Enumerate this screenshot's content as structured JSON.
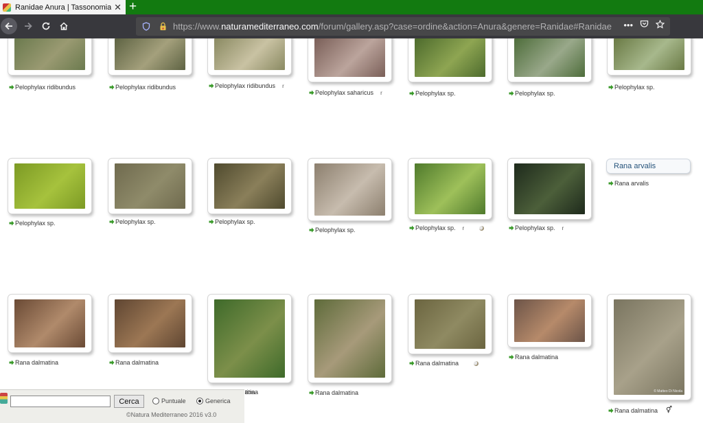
{
  "browser": {
    "tab_title": "Ranidae Anura | Tassonomia Ra",
    "url_scheme": "https://www.",
    "url_host": "naturamediterraneo.com",
    "url_path": "/forum/gallery.asp?case=ordine&action=Anura&genere=Ranidae#Ranidae",
    "icons": [
      "back-icon",
      "forward-icon",
      "reload-icon",
      "home-icon",
      "shield-icon",
      "lock-icon",
      "more-icon",
      "pocket-icon",
      "bookmark-star-icon",
      "close-icon",
      "plus-icon"
    ]
  },
  "gallery": {
    "genus_label": "Rana arvalis",
    "items": [
      {
        "name": "Pelophylax ridibundus",
        "extra": "",
        "moon": false,
        "gender": "",
        "colors": [
          "#6b7a4e",
          "#9a9a72"
        ]
      },
      {
        "name": "Pelophylax ridibundus",
        "extra": "",
        "moon": false,
        "gender": "",
        "colors": [
          "#5e6343",
          "#a4a07c"
        ]
      },
      {
        "name": "Pelophylax ridibundus",
        "extra": "r",
        "moon": false,
        "gender": "",
        "colors": [
          "#8a8a62",
          "#c9c2a3"
        ]
      },
      {
        "name": "Pelophylax saharicus",
        "extra": "r",
        "moon": false,
        "gender": "",
        "colors": [
          "#7a5f58",
          "#bba49c"
        ]
      },
      {
        "name": "Pelophylax sp.",
        "extra": "",
        "moon": false,
        "gender": "",
        "colors": [
          "#4d6b2d",
          "#8ea552"
        ]
      },
      {
        "name": "Pelophylax sp.",
        "extra": "",
        "moon": false,
        "gender": "",
        "colors": [
          "#4e6d3b",
          "#99a88a"
        ]
      },
      {
        "name": "Pelophylax sp.",
        "extra": "",
        "moon": false,
        "gender": "",
        "colors": [
          "#6a7a45",
          "#a7b88c"
        ]
      },
      {
        "name": "Pelophylax sp.",
        "extra": "",
        "moon": false,
        "gender": "",
        "colors": [
          "#7c9a24",
          "#a6c23d"
        ]
      },
      {
        "name": "Pelophylax sp.",
        "extra": "",
        "moon": false,
        "gender": "",
        "colors": [
          "#6f6a4e",
          "#8f8b6a"
        ]
      },
      {
        "name": "Pelophylax sp.",
        "extra": "",
        "moon": false,
        "gender": "",
        "colors": [
          "#4f4a2e",
          "#8a7f5a"
        ]
      },
      {
        "name": "Pelophylax sp.",
        "extra": "",
        "moon": false,
        "gender": "",
        "colors": [
          "#8c7f6e",
          "#c7bcae"
        ]
      },
      {
        "name": "Pelophylax sp.",
        "extra": "r",
        "moon": true,
        "gender": "",
        "colors": [
          "#4f7a2c",
          "#9ec05a"
        ]
      },
      {
        "name": "Pelophylax sp.",
        "extra": "r",
        "moon": false,
        "gender": "",
        "colors": [
          "#1e2a1c",
          "#4c5f3a"
        ]
      },
      {
        "name": "Rana arvalis",
        "extra": "",
        "moon": false,
        "gender": "",
        "colors": [
          "#ffffff",
          "#ffffff"
        ]
      },
      {
        "name": "Rana dalmatina",
        "extra": "",
        "moon": false,
        "gender": "",
        "colors": [
          "#6a4a35",
          "#b08a6b"
        ]
      },
      {
        "name": "Rana dalmatina",
        "extra": "",
        "moon": false,
        "gender": "",
        "colors": [
          "#5f4632",
          "#9c7754"
        ]
      },
      {
        "name": "Rana dalmatina",
        "extra": "",
        "moon": false,
        "gender": "",
        "colors": [
          "#3e6a2a",
          "#7c8f4a"
        ]
      },
      {
        "name": "Rana dalmatina",
        "extra": "",
        "moon": false,
        "gender": "",
        "colors": [
          "#5e6b3a",
          "#a79a7a"
        ]
      },
      {
        "name": "Rana dalmatina",
        "extra": "",
        "moon": true,
        "gender": "",
        "colors": [
          "#6b6540",
          "#8f8a62"
        ]
      },
      {
        "name": "Rana dalmatina",
        "extra": "",
        "moon": false,
        "gender": "",
        "colors": [
          "#6c5448",
          "#b68a6a"
        ]
      },
      {
        "name": "Rana dalmatina",
        "extra": "",
        "moon": false,
        "gender": "⚥",
        "colors": [
          "#7a7560",
          "#a8a18a"
        ]
      }
    ],
    "row3_col3_caption": "tina",
    "photo_credit": "© Matteo Di Nicola"
  },
  "search": {
    "input_value": "",
    "button_label": "Cerca",
    "option_puntuale": "Puntuale",
    "option_generica": "Generica",
    "selected": "Generica",
    "copyright": "©Natura Mediterraneo 2016 v3.0"
  }
}
